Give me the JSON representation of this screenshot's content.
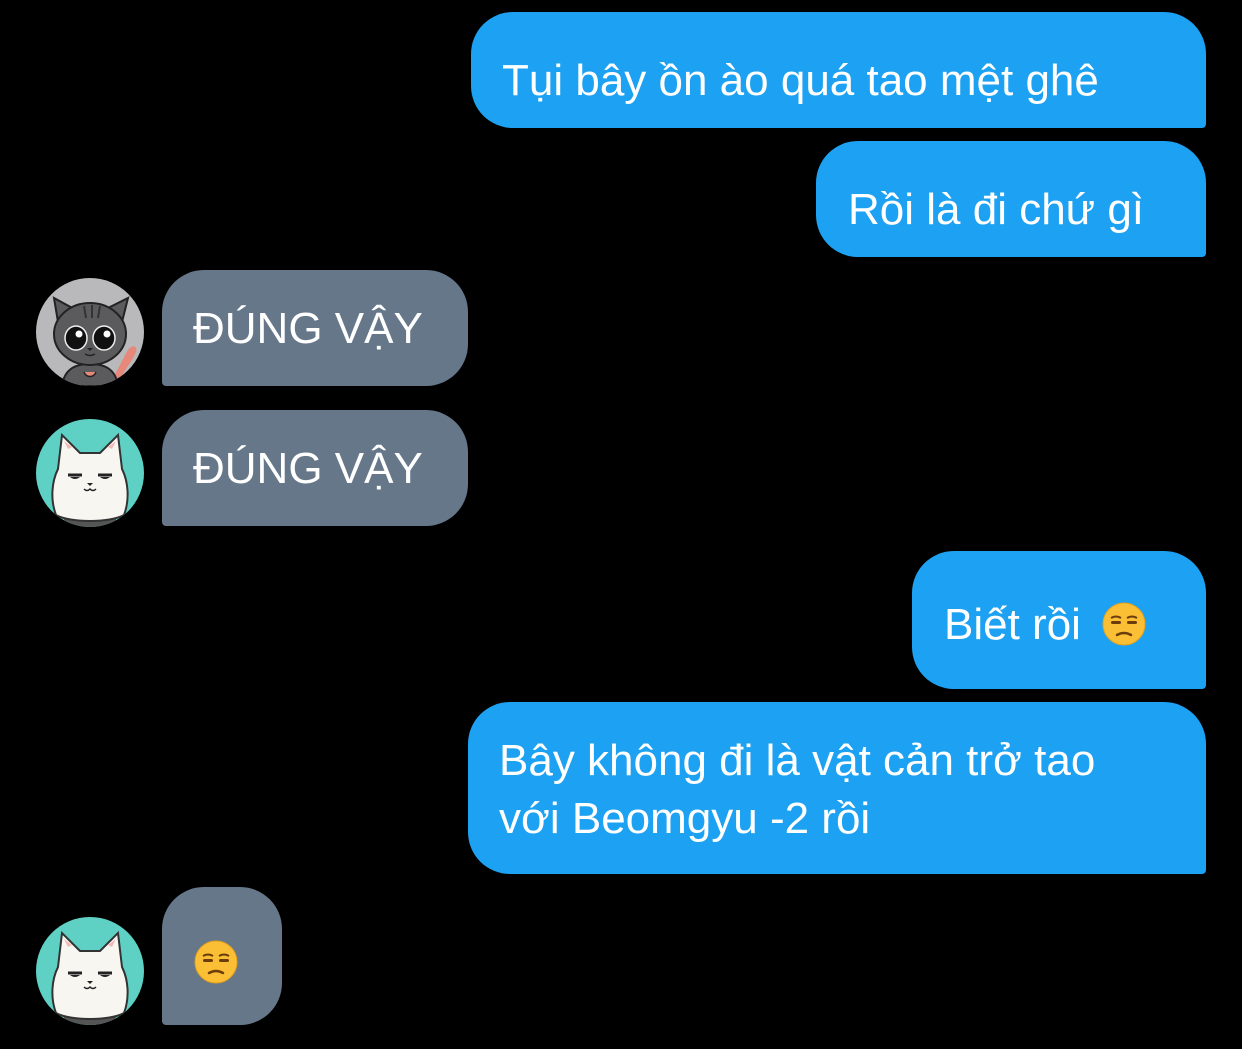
{
  "colors": {
    "background": "#000000",
    "outgoing_bubble": "#1da1f2",
    "incoming_bubble": "#66778a",
    "avatar_gray_bg": "#b9b9bb",
    "avatar_teal_bg": "#5fd0c4"
  },
  "messages": [
    {
      "direction": "outgoing",
      "text": "Tụi bây ồn ào quá tao mệt ghê"
    },
    {
      "direction": "outgoing",
      "text": "Rồi là đi chứ gì"
    },
    {
      "direction": "incoming",
      "avatar": "gray-cat-avatar",
      "text": "ĐÚNG VẬY"
    },
    {
      "direction": "incoming",
      "avatar": "white-cat-avatar",
      "text": "ĐÚNG VẬY"
    },
    {
      "direction": "outgoing",
      "text": "Biết rồi",
      "emoji": "unamused-face-emoji"
    },
    {
      "direction": "outgoing",
      "text": "Bây không đi là vật cản trở tao\nvới Beomgyu -2 rồi"
    },
    {
      "direction": "incoming",
      "avatar": "white-cat-avatar",
      "emoji": "unamused-face-emoji"
    }
  ]
}
